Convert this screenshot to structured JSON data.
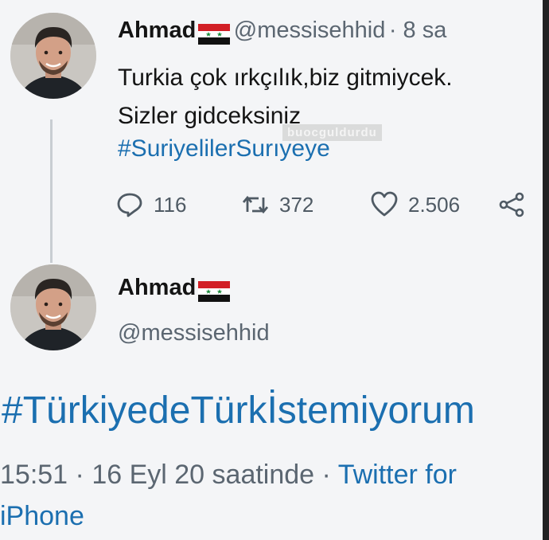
{
  "tweet1": {
    "name": "Ahmad",
    "handle": "@messisehhid",
    "time": "8 sa",
    "line1": "Turkia çok ırkçılık,biz gitmiycek.",
    "line2": "Sizler gidceksiniz",
    "hashtag": "#SuriyelilerSurıyeye",
    "replies": "116",
    "retweets": "372",
    "likes": "2.506"
  },
  "watermark": "buocguldurdu",
  "tweet2": {
    "name": "Ahmad",
    "handle": "@messisehhid",
    "hashtag": "#TürkiyedeTürkİstemiyorum",
    "timestamp": "15:51",
    "date": "16 Eyl 20 saatinde",
    "source_line1": "Twitter for",
    "source_line2": "iPhone"
  },
  "colors": {
    "link": "#1b6fb0",
    "text": "#141414",
    "muted": "#5b6671"
  },
  "icons": [
    "syrian-flag-icon",
    "reply-icon",
    "retweet-icon",
    "like-icon",
    "share-icon"
  ]
}
